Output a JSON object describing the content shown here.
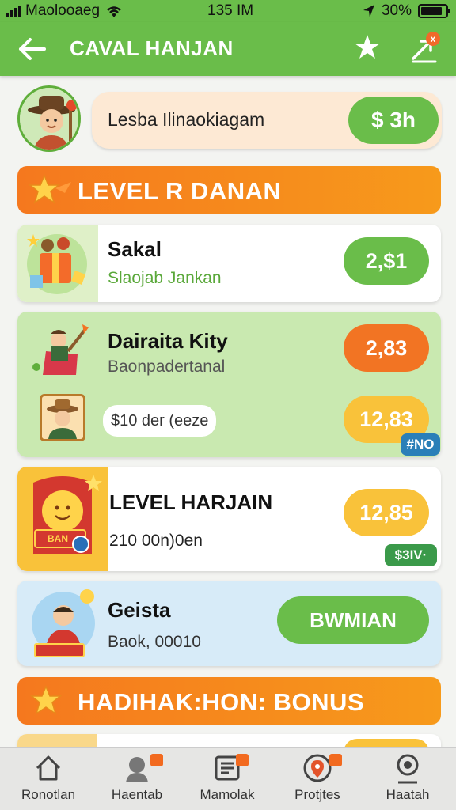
{
  "status_bar": {
    "carrier": "Maolooaeg",
    "time": "135 IM",
    "battery_percent": "30%"
  },
  "header": {
    "title": "CAVAL HANJAN",
    "notification_count": "x"
  },
  "profile": {
    "name": "Lesba Ilinaokiagam",
    "balance": "$ 3h"
  },
  "level_banner": {
    "label": "LEVEL R DANAN"
  },
  "cards": [
    {
      "title": "Sakal",
      "subtitle": "Slaojab Jankan",
      "value": "2,$1",
      "value_color": "#6abd4a"
    },
    {
      "title": "Dairaita Kity",
      "subtitle": "Baonpadertanal",
      "value": "2,83",
      "value_color": "#f27423",
      "sub_chip": "$10 der (eeze",
      "sub_value": "12,83",
      "tag": "#NO"
    },
    {
      "title": "LEVEL HARJAIN",
      "subtitle": "210 00n)0en",
      "value": "12,85",
      "value_color": "#f9c23a",
      "tag": "$3IV·",
      "badge_text": "BAN"
    },
    {
      "title": "Geista",
      "subtitle": "Baok, 00010",
      "action": "BWMIAN"
    }
  ],
  "bonus_banner": {
    "label": "HADIHAK:HON: BONUS"
  },
  "bottom_nav": [
    {
      "label": "Ronotlan",
      "icon": "home-icon"
    },
    {
      "label": "Haentab",
      "icon": "user-icon"
    },
    {
      "label": "Mamolak",
      "icon": "list-icon"
    },
    {
      "label": "Protjtes",
      "icon": "map-pin-icon"
    },
    {
      "label": "Haatah",
      "icon": "profile-icon"
    }
  ],
  "colors": {
    "primary_green": "#6abd4a",
    "accent_orange": "#f27423",
    "yellow": "#f9c23a"
  }
}
